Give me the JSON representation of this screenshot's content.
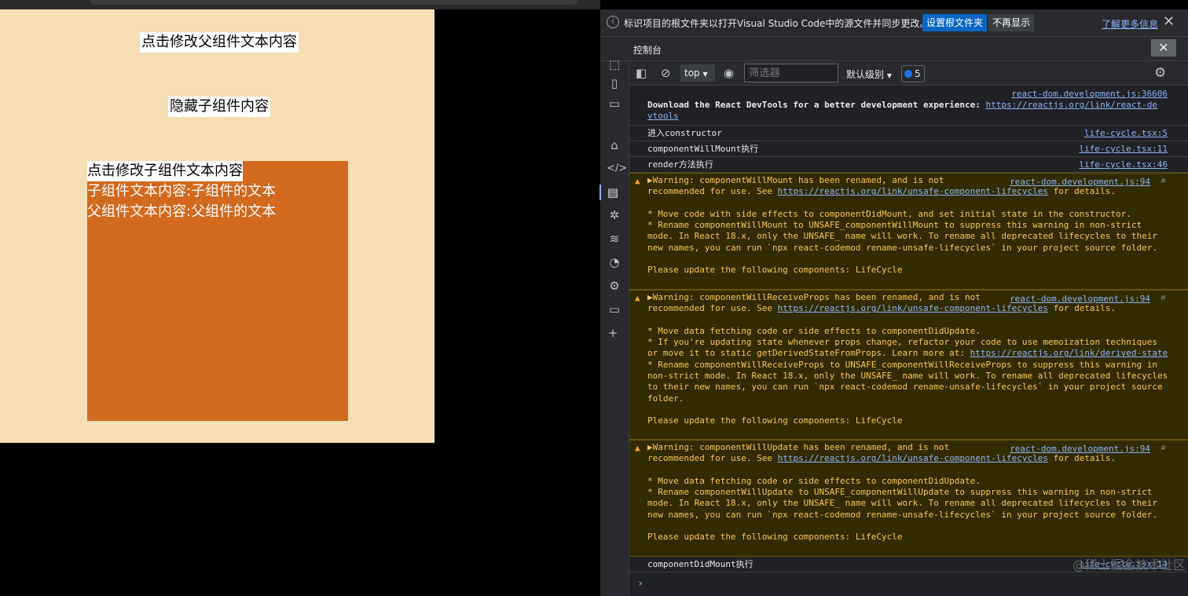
{
  "page": {
    "parent_button": "点击修改父组件文本内容",
    "hide_button": "隐藏子组件内容",
    "child": {
      "button": "点击修改子组件文本内容",
      "child_text": "子组件文本内容:子组件的文本",
      "parent_text": "父组件文本内容:父组件的文本"
    }
  },
  "devtools": {
    "infobar": {
      "message": "标识项目的根文件夹以打开Visual Studio Code中的源文件并同步更改。",
      "primary_button": "设置根文件夹",
      "secondary_button": "不再显示",
      "learn_more": "了解更多信息"
    },
    "panel_title": "控制台",
    "toolbar": {
      "context": "top",
      "filter_placeholder": "筛选器",
      "level": "默认级别",
      "message_count": "5"
    },
    "entries": {
      "e0": {
        "src": "react-dom.development.js:36606",
        "text": "Download the React DevTools for a better development experience: ",
        "link": "https://reactjs.org/link/react-devtools"
      },
      "e1": {
        "src": "life-cycle.tsx:5",
        "text": "进入constructor"
      },
      "e2": {
        "src": "life-cycle.tsx:11",
        "text": "componentWillMount执行"
      },
      "e3": {
        "src": "life-cycle.tsx:46",
        "text": "render方法执行"
      },
      "w1": {
        "src": "react-dom.development.js:94",
        "line1": "Warning: componentWillMount has been renamed, and is not",
        "line2": "recommended for use. See ",
        "link": "https://reactjs.org/link/unsafe-component-lifecycles",
        "line3": " for details.",
        "body": "* Move code with side effects to componentDidMount, and set initial state in the constructor.\n* Rename componentWillMount to UNSAFE_componentWillMount to suppress this warning in non-strict\nmode. In React 18.x, only the UNSAFE_ name will work. To rename all deprecated lifecycles to their\nnew names, you can run `npx react-codemod rename-unsafe-lifecycles` in your project source folder.\n\nPlease update the following components: LifeCycle"
      },
      "w2": {
        "src": "react-dom.development.js:94",
        "line1": "Warning: componentWillReceiveProps has been renamed, and is not",
        "line2": "recommended for use. See ",
        "link": "https://reactjs.org/link/unsafe-component-lifecycles",
        "line3": " for details.",
        "body_a": "* Move data fetching code or side effects to componentDidUpdate.\n* If you're updating state whenever props change, refactor your code to use memoization techniques\nor move it to static getDerivedStateFromProps. Learn more at: ",
        "body_link": "https://reactjs.org/link/derived-state",
        "body_b": "* Rename componentWillReceiveProps to UNSAFE_componentWillReceiveProps to suppress this warning in\nnon-strict mode. In React 18.x, only the UNSAFE_ name will work. To rename all deprecated lifecycles\nto their new names, you can run `npx react-codemod rename-unsafe-lifecycles` in your project source\nfolder.\n\nPlease update the following components: LifeCycle"
      },
      "w3": {
        "src": "react-dom.development.js:94",
        "line1": "Warning: componentWillUpdate has been renamed, and is not",
        "line2": "recommended for use. See ",
        "link": "https://reactjs.org/link/unsafe-component-lifecycles",
        "line3": " for details.",
        "body": "* Move data fetching code or side effects to componentDidUpdate.\n* Rename componentWillUpdate to UNSAFE_componentWillUpdate to suppress this warning in non-strict\nmode. In React 18.x, only the UNSAFE_ name will work. To rename all deprecated lifecycles to their\nnew names, you can run `npx react-codemod rename-unsafe-lifecycles` in your project source folder.\n\nPlease update the following components: LifeCycle"
      },
      "e4": {
        "src": "life-cycle.tsx:14",
        "text": "componentDidMount执行"
      }
    },
    "prompt": "›"
  },
  "watermark": "@稀土掘金技术社区",
  "colors": {
    "page_bg": "#f5deb3",
    "child_bg": "#d2691e",
    "link": "#8ab4f8",
    "warning_text": "#f4c55b",
    "warning_bg": "#332b00"
  }
}
